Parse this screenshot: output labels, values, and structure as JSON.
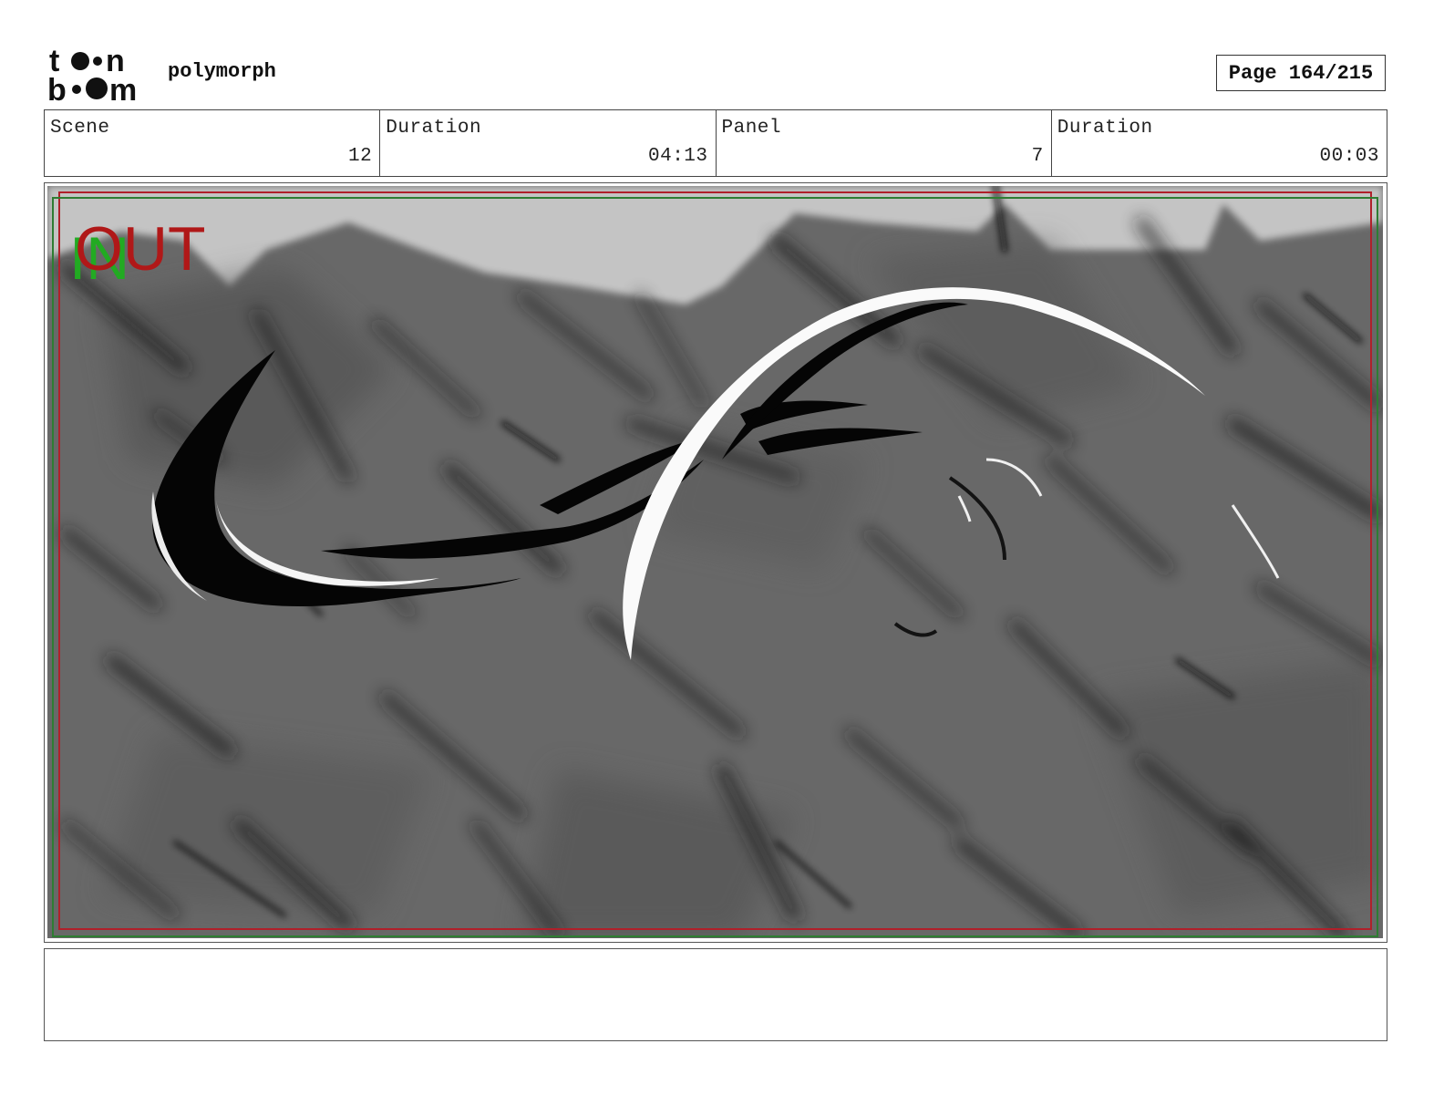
{
  "header": {
    "logo_top": "toon",
    "logo_bottom": "boom",
    "project_name": "polymorph",
    "page_label": "Page 164/215"
  },
  "info": [
    {
      "label": "Scene",
      "value": "12"
    },
    {
      "label": "Duration",
      "value": "04:13"
    },
    {
      "label": "Panel",
      "value": "7"
    },
    {
      "label": "Duration",
      "value": "00:03"
    }
  ],
  "panel": {
    "in_marker": "IN",
    "out_marker": "OUT",
    "colors": {
      "background": "#6a6a6a",
      "sky": "#c6c6c6",
      "safe_red": "#b0202a",
      "safe_green": "#2e7d32",
      "in_text": "#22aa22",
      "out_text": "#b01818"
    }
  },
  "notes": {
    "text": ""
  }
}
